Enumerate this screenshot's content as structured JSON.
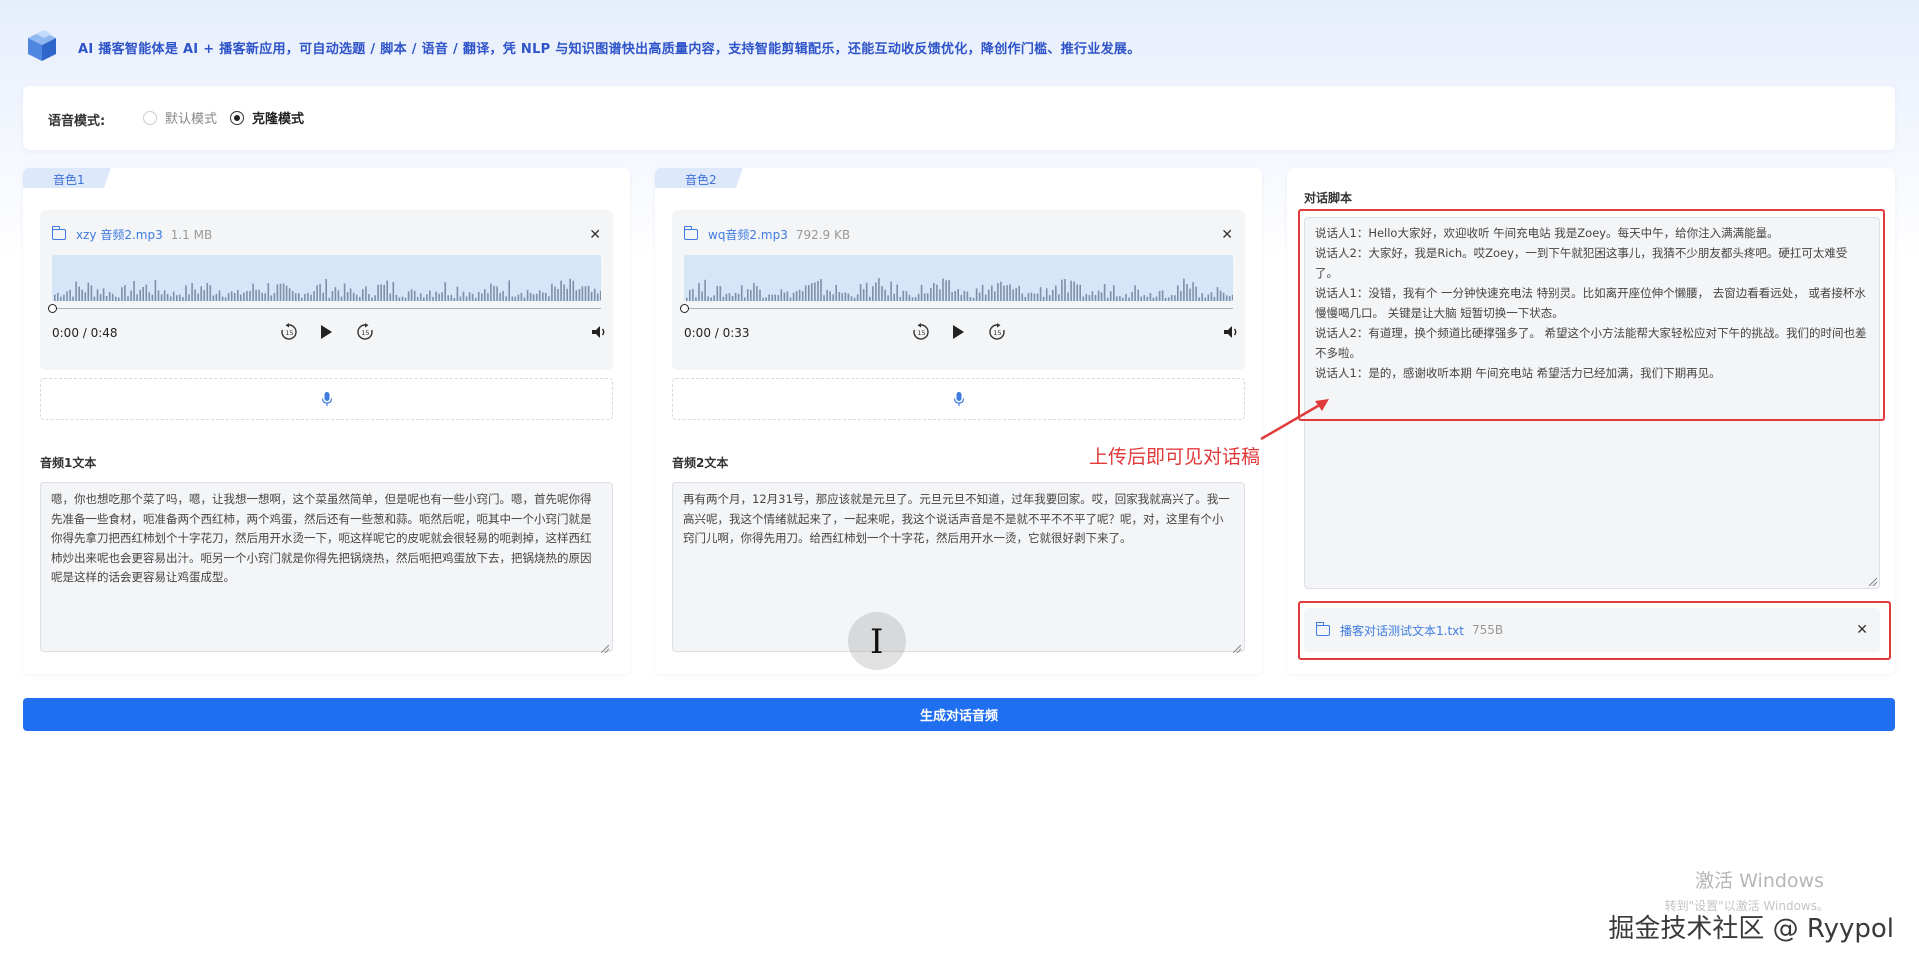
{
  "header": {
    "description": "AI 播客智能体是 AI + 播客新应用，可自动选题 / 脚本 / 语音 / 翻译，凭 NLP 与知识图谱快出高质量内容，支持智能剪辑配乐，还能互动收反馈优化，降创作门槛、推行业发展。"
  },
  "voice_mode": {
    "label": "语音模式:",
    "options": [
      "默认模式",
      "克隆模式"
    ],
    "selected": "克隆模式"
  },
  "voices": [
    {
      "tab": "音色1",
      "file_name": "xzy 音频2.mp3",
      "file_size": "1.1 MB",
      "time": "0:00 / 0:48",
      "text_label": "音频1文本",
      "text": "嗯，你也想吃那个菜了吗，嗯，让我想一想啊，这个菜虽然简单，但是呢也有一些小窍门。嗯，首先呢你得先准备一些食材，呃准备两个西红柿，两个鸡蛋，然后还有一些葱和蒜。呃然后呢，呃其中一个小窍门就是你得先拿刀把西红柿划个十字花刀，然后用开水烫一下，呃这样呢它的皮呢就会很轻易的呃剥掉，这样西红柿炒出来呢也会更容易出汁。呃另一个小窍门就是你得先把锅烧热，然后呃把鸡蛋放下去，把锅烧热的原因呢是这样的话会更容易让鸡蛋成型。"
    },
    {
      "tab": "音色2",
      "file_name": "wq音频2.mp3",
      "file_size": "792.9 KB",
      "time": "0:00 / 0:33",
      "text_label": "音频2文本",
      "text": "再有两个月，12月31号，那应该就是元旦了。元旦元旦不知道，过年我要回家。哎，回家我就高兴了。我一高兴呢，我这个情绪就起来了，一起来呢，我这个说话声音是不是就不平不不平了呢？呢，对，这里有个小窍门儿啊，你得先用刀。给西红柿划一个十字花，然后用开水一烫，它就很好剥下来了。"
    }
  ],
  "script": {
    "label": "对话脚本",
    "lines": [
      "说话人1：Hello大家好，欢迎收听 午间充电站 我是Zoey。每天中午，给你注入满满能量。",
      "说话人2：大家好，我是Rich。哎Zoey，一到下午就犯困这事儿，我猜不少朋友都头疼吧。硬扛可太难受了。",
      "说话人1：没错，我有个 一分钟快速充电法 特别灵。比如离开座位伸个懒腰， 去窗边看看远处， 或者接杯水慢慢喝几口。 关键是让大脑 短暂切换一下状态。",
      "说话人2：有道理，换个频道比硬撑强多了。 希望这个小方法能帮大家轻松应对下午的挑战。我们的时间也差不多啦。",
      "说话人1：是的，感谢收听本期 午间充电站 希望活力已经加满，我们下期再见。"
    ],
    "file_name": "播客对话测试文本1.txt",
    "file_size": "755B"
  },
  "annotation": "上传后即可见对话稿",
  "generate_button": "生成对话音频",
  "watermarks": {
    "windows_1": "激活 Windows",
    "windows_2": "转到\"设置\"以激活 Windows。",
    "juejin": "掘金技术社区 @ Ryypol"
  },
  "colors": {
    "primary": "#1f6ff0",
    "link": "#3f7be0",
    "annotation_red": "#e03a3a",
    "tab_bg": "#dde9fb"
  },
  "icons": [
    "logo-cube-icon",
    "folder-icon",
    "close-icon",
    "rewind-15-icon",
    "play-icon",
    "forward-15-icon",
    "volume-icon",
    "microphone-icon"
  ]
}
